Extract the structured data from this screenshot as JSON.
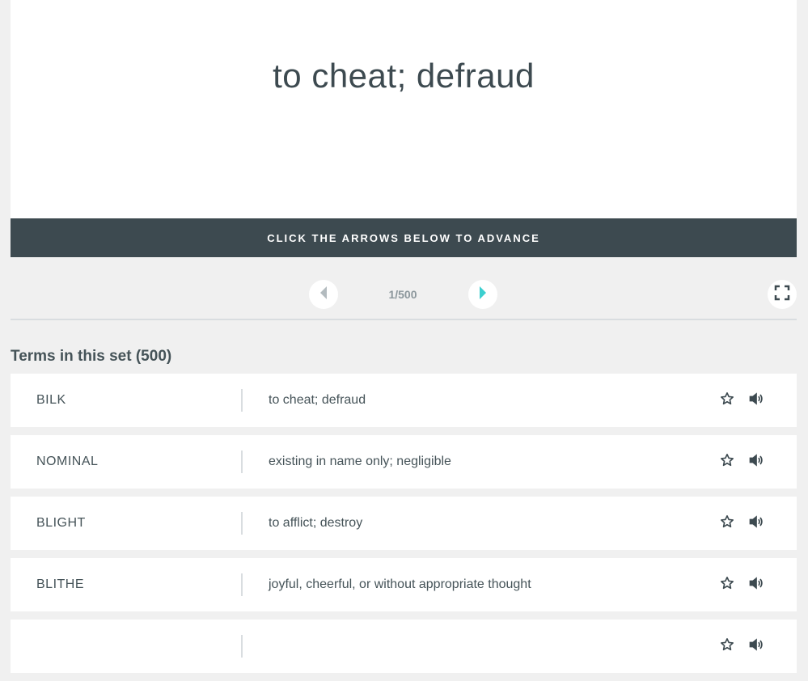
{
  "card": {
    "text": "to cheat; defraud"
  },
  "advance_banner": "CLICK THE ARROWS BELOW TO ADVANCE",
  "controls": {
    "counter": "1/500"
  },
  "terms_section": {
    "title": "Terms in this set (500)",
    "items": [
      {
        "term": "BILK",
        "definition": "to cheat; defraud"
      },
      {
        "term": "NOMINAL",
        "definition": "existing in name only; negligible"
      },
      {
        "term": "BLIGHT",
        "definition": "to afflict; destroy"
      },
      {
        "term": "BLITHE",
        "definition": "joyful, cheerful, or without appropriate thought"
      },
      {
        "term": "",
        "definition": ""
      }
    ]
  },
  "colors": {
    "accent": "#3ccfcf",
    "dark": "#3d4a50",
    "background": "#f0f0f0",
    "arrow_disabled": "#b3bbbf"
  },
  "icons": {
    "prev": "arrow-left-icon",
    "next": "arrow-right-icon",
    "fullscreen": "fullscreen-icon",
    "star": "star-icon",
    "audio": "speaker-icon"
  }
}
